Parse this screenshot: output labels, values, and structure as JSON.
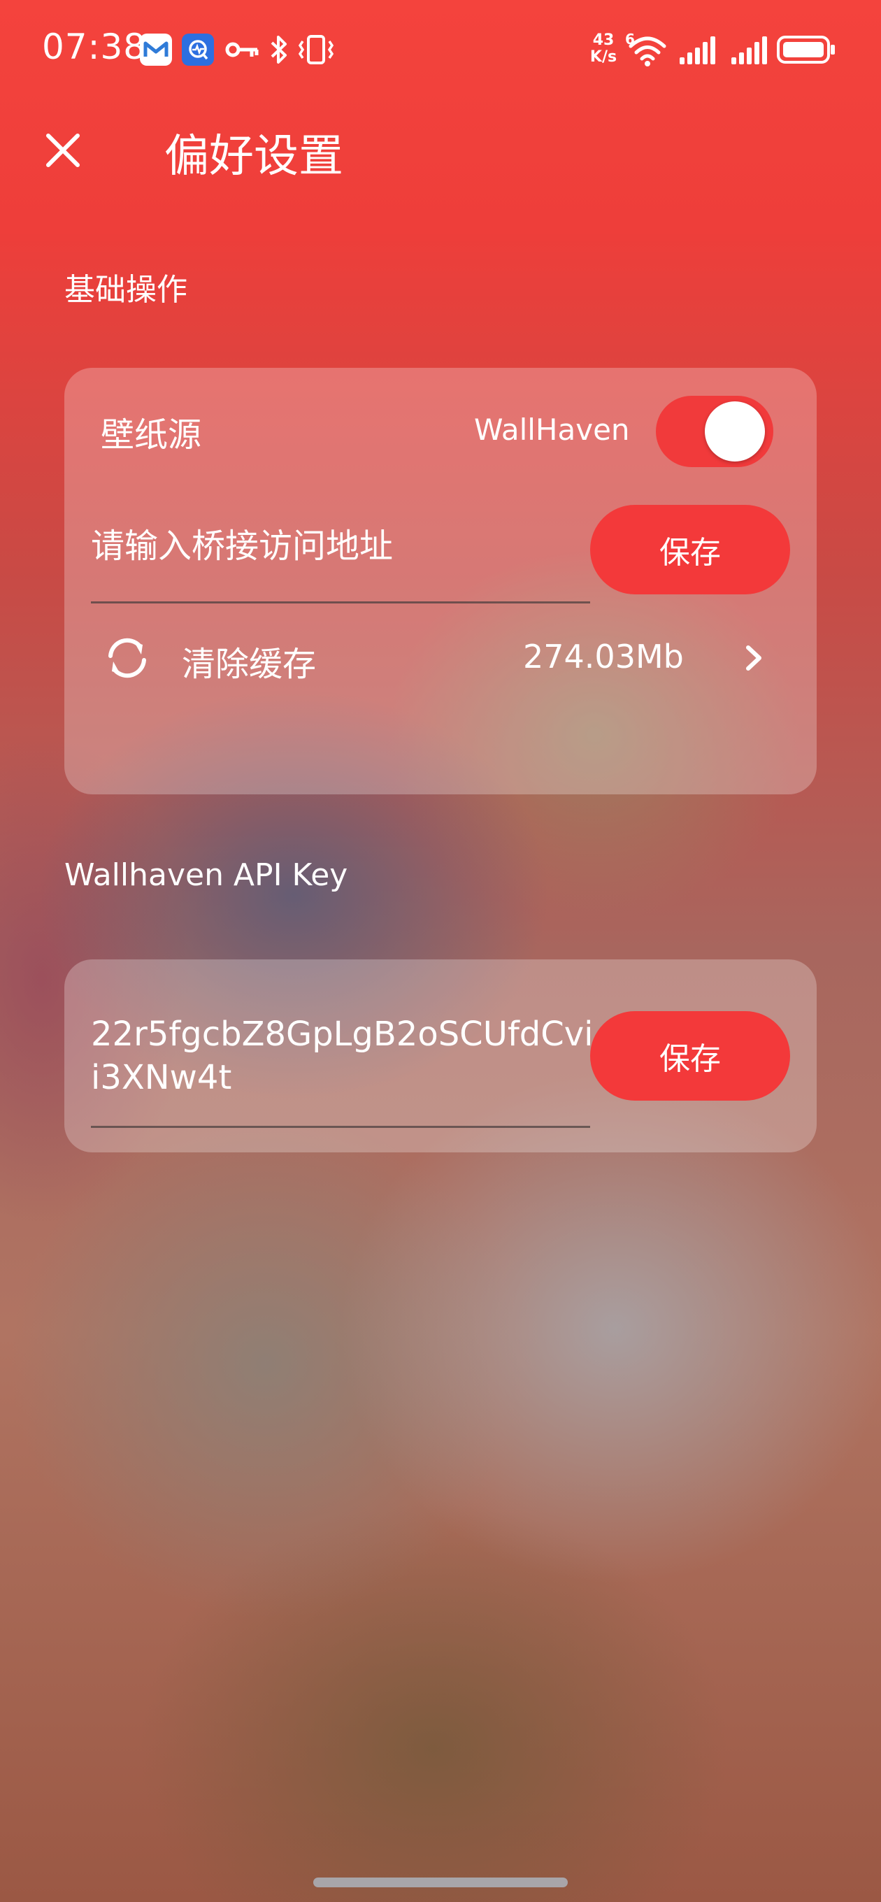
{
  "status_bar": {
    "time": "07:38",
    "net_speed_value": "43",
    "net_speed_unit": "K/s",
    "wifi_label": "6",
    "icons": [
      "mail-app-icon",
      "monitor-app-icon",
      "key-icon",
      "bluetooth-icon",
      "vibrate-icon",
      "wifi-icon",
      "signal-icon-1",
      "signal-icon-2",
      "battery-icon"
    ]
  },
  "header": {
    "close_icon": "close-icon",
    "title": "偏好设置"
  },
  "basic_section": {
    "title": "基础操作",
    "wallpaper_source": {
      "label": "壁纸源",
      "value": "WallHaven",
      "toggle_on": true
    },
    "bridge": {
      "placeholder": "请输入桥接访问地址",
      "value": "",
      "save_label": "保存"
    },
    "cache": {
      "icon": "refresh-icon",
      "label": "清除缓存",
      "size": "274.03Mb",
      "chevron": "chevron-right-icon"
    }
  },
  "api_section": {
    "title": "Wallhaven API Key",
    "key_value": "22r5fgcbZ8GpLgB2oSCUfdCvii3XNw4t",
    "save_label": "保存"
  },
  "colors": {
    "accent": "#f3393a",
    "header_bg": "#f4433d"
  }
}
